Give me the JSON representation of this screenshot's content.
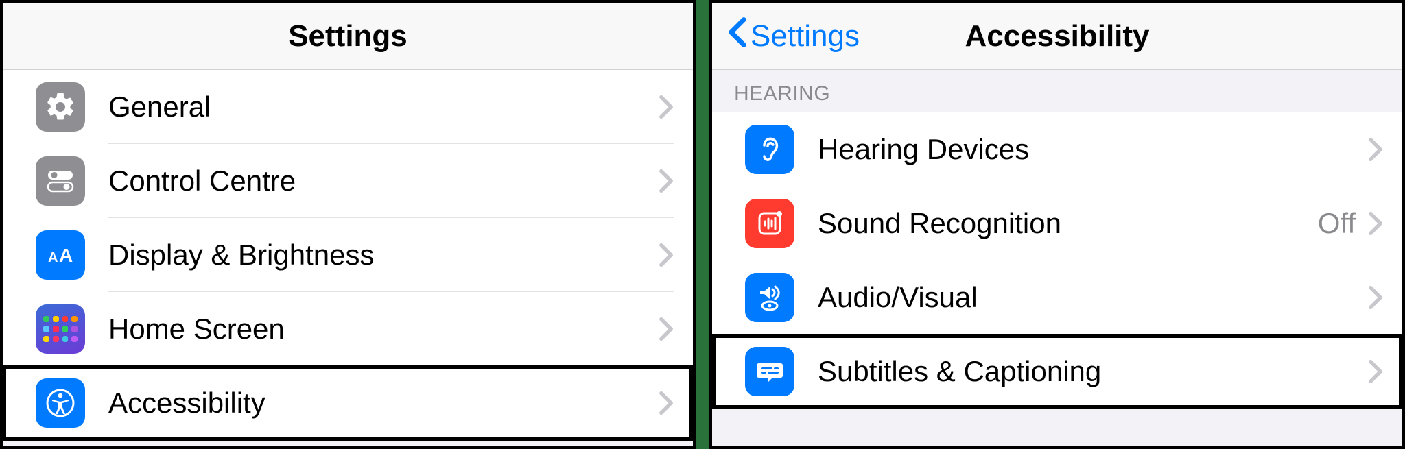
{
  "left": {
    "title": "Settings",
    "items": [
      {
        "label": "General"
      },
      {
        "label": "Control Centre"
      },
      {
        "label": "Display & Brightness"
      },
      {
        "label": "Home Screen"
      },
      {
        "label": "Accessibility"
      }
    ]
  },
  "right": {
    "back_label": "Settings",
    "title": "Accessibility",
    "section_header": "HEARING",
    "items": [
      {
        "label": "Hearing Devices",
        "value": ""
      },
      {
        "label": "Sound Recognition",
        "value": "Off"
      },
      {
        "label": "Audio/Visual",
        "value": ""
      },
      {
        "label": "Subtitles & Captioning",
        "value": ""
      }
    ]
  }
}
